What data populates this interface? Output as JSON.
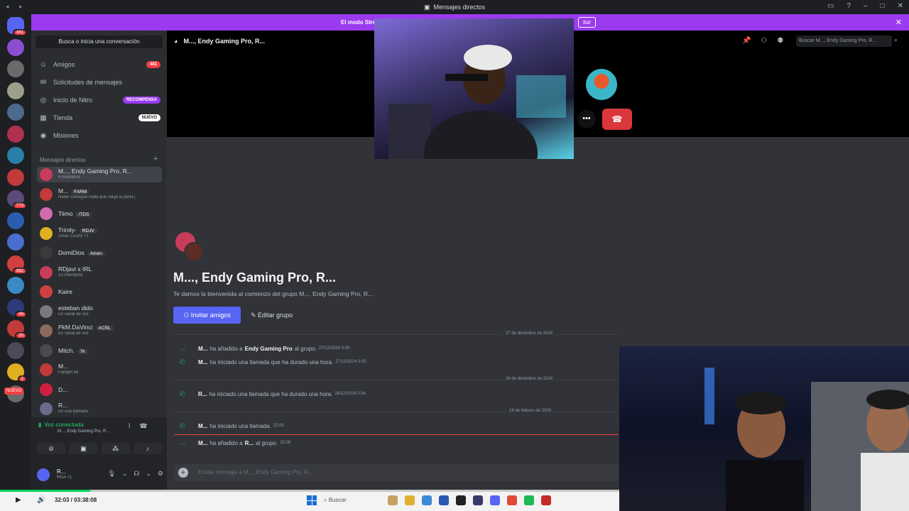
{
  "titlebar": {
    "title": "Mensajes directos"
  },
  "banner": {
    "text": "El modo Stre",
    "button": "itar"
  },
  "servers": [
    {
      "color": "#5865f2",
      "badge": "481"
    },
    {
      "color": "#8a4fd1",
      "badge": ""
    },
    {
      "color": "#6b6b6b",
      "badge": ""
    },
    {
      "color": "#9aa08a",
      "badge": ""
    },
    {
      "color": "#4c6a8c",
      "badge": ""
    },
    {
      "color": "#b03050",
      "badge": ""
    },
    {
      "color": "#2a7fa8",
      "badge": ""
    },
    {
      "color": "#c23a3a",
      "badge": ""
    },
    {
      "color": "#5e4a7a",
      "badge": "773"
    },
    {
      "color": "#2a5db0",
      "badge": ""
    },
    {
      "color": "#4a6ed0",
      "badge": ""
    },
    {
      "color": "#d04040",
      "badge": "882"
    },
    {
      "color": "#3a8ac8",
      "badge": ""
    },
    {
      "color": "#2f3a7a",
      "badge": "48"
    },
    {
      "color": "#c23a3a",
      "badge": "30"
    },
    {
      "color": "#4a4a5a",
      "badge": ""
    },
    {
      "color": "#e0b020",
      "badge": "2"
    },
    {
      "color": "#6a6a6a",
      "badge": ""
    }
  ],
  "new_label": "NUEVO",
  "sidebar": {
    "search": "Busca o inicia una conversación",
    "nav": [
      {
        "label": "Amigos",
        "pill": "481",
        "pill_color": "#f23f43"
      },
      {
        "label": "Solicitudes de mensajes",
        "pill": "",
        "pill_color": ""
      },
      {
        "label": "Inicio de Nitro",
        "pill": "RECOMPENSA",
        "pill_color": "#9b3bf0"
      },
      {
        "label": "Tienda",
        "pill": "NUEVO",
        "pill_color": "#5865f2"
      },
      {
        "label": "Misiones",
        "pill": "",
        "pill_color": ""
      }
    ],
    "dm_header": "Mensajes directos",
    "dms": [
      {
        "name": "M..., Endy Gaming Pro, R...",
        "tag": "",
        "sub": "4 miembros",
        "color": "#c93c5a"
      },
      {
        "name": "M...",
        "tag": "FARM",
        "sub": "Nadie consigue nada que valga la pena j",
        "color": "#c23a3a"
      },
      {
        "name": "Tiimo",
        "tag": "/TDS",
        "sub": "",
        "color": "#d06bb0"
      },
      {
        "name": "Trinity-",
        "tag": "RDJV",
        "sub": "Omar Courtz +1",
        "color": "#e0b020"
      },
      {
        "name": "DomiDios",
        "tag": "Amén",
        "sub": "",
        "color": "#3a3a3a"
      },
      {
        "name": "RDjavi x IRL",
        "tag": "",
        "sub": "10 miembros",
        "color": "#c93c5a"
      },
      {
        "name": "Kaire",
        "tag": "",
        "sub": "",
        "color": "#d04040"
      },
      {
        "name": "esteban dido",
        "tag": "",
        "sub": "En canal de voz",
        "color": "#7a7a7a"
      },
      {
        "name": "PkM.DaVinci",
        "tag": "ACÑL",
        "sub": "En canal de voz",
        "color": "#8a6a5a"
      },
      {
        "name": "Mitch.",
        "tag": "7k",
        "sub": "",
        "color": "#4a4a4a"
      },
      {
        "name": "M...",
        "tag": "",
        "sub": "Farlight 84",
        "color": "#c23a3a"
      },
      {
        "name": "D...",
        "tag": "",
        "sub": "",
        "color": "#d02040"
      },
      {
        "name": "R...",
        "tag": "",
        "sub": "En una llamada",
        "color": "#6a6a8a"
      }
    ]
  },
  "voice": {
    "status": "Voz conectada",
    "channel": "M..., Endy Gaming Pro, R...",
    "user_name": "R...",
    "user_sub": "ROA +1"
  },
  "main": {
    "channel_title": "M..., Endy Gaming Pro, R...",
    "search_placeholder": "Buscar M..., Endy Gaming Pro, R...",
    "welcome_title": "M..., Endy Gaming Pro, R...",
    "welcome_sub": "Te damos la bienvenida al comienzo del grupo M..., Endy Gaming Pro, R...",
    "invite_label": "Invitar amigos",
    "edit_label": "Editar grupo",
    "dates": [
      "27 de diciembre de 2024",
      "28 de diciembre de 2024",
      "18 de febrero de 2026"
    ],
    "messages": [
      {
        "who": "M...",
        "text": "ha añadido a",
        "highlight": "Endy Gaming Pro",
        "rest": "al grupo.",
        "ts": "27/12/2024 0:00",
        "arrow": "→"
      },
      {
        "who": "M...",
        "text": "ha iniciado una llamada que ha durado una hora.",
        "highlight": "",
        "rest": "",
        "ts": "27/12/2024 0:00",
        "arrow": "✆"
      },
      {
        "who": "R...",
        "text": "ha iniciado una llamada que ha durado una hora.",
        "highlight": "",
        "rest": "",
        "ts": "28/12/2024 0:34",
        "arrow": "✆"
      },
      {
        "who": "M...",
        "text": "ha iniciado una llamada.",
        "highlight": "",
        "rest": "",
        "ts": "22:00",
        "arrow": "✆"
      },
      {
        "who": "M...",
        "text": "ha añadido a",
        "highlight": "R...",
        "rest": "al grupo.",
        "ts": "22:09",
        "arrow": "→"
      }
    ],
    "composer_placeholder": "Enviar mensaje a M..., Endy Gaming Pro, R..."
  },
  "player": {
    "time": "32:03 / 03:38:08",
    "progress": 0.146
  },
  "taskbar": {
    "search": "Buscar"
  }
}
